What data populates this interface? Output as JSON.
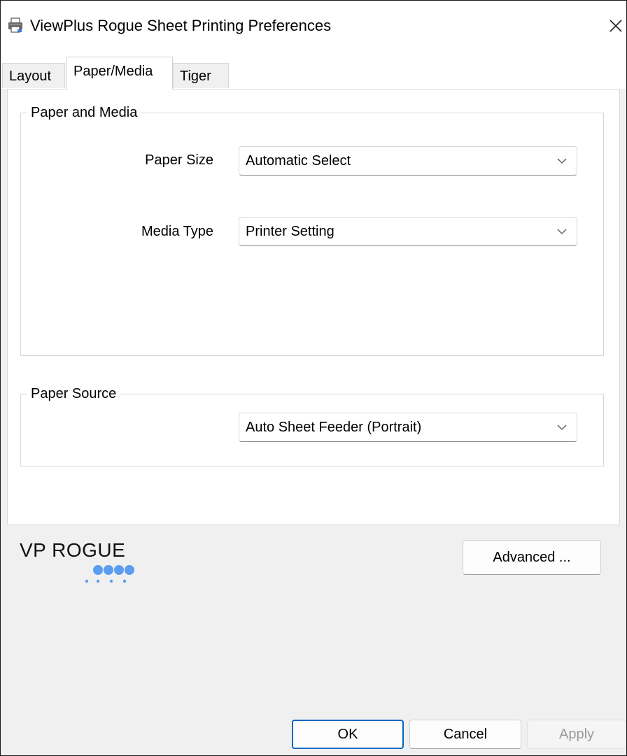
{
  "window": {
    "title": "ViewPlus Rogue Sheet Printing Preferences",
    "icon": "printer-icon",
    "close_icon": "close-icon"
  },
  "tabs": [
    {
      "label": "Layout",
      "active": false
    },
    {
      "label": "Paper/Media",
      "active": true
    },
    {
      "label": "Tiger",
      "active": false
    }
  ],
  "paper_and_media": {
    "group_label": "Paper and Media",
    "paper_size": {
      "label": "Paper Size",
      "value": "Automatic Select"
    },
    "media_type": {
      "label": "Media Type",
      "value": "Printer Setting"
    }
  },
  "paper_source": {
    "group_label": "Paper Source",
    "value": "Auto Sheet Feeder (Portrait)"
  },
  "logo": {
    "text": "VP ROGUE",
    "dot_color": "#5b9df0"
  },
  "advanced_button": {
    "label": "Advanced ..."
  },
  "footer": {
    "ok": "OK",
    "cancel": "Cancel",
    "apply": "Apply"
  },
  "colors": {
    "accent": "#0067c0",
    "disabled_text": "#9a9a9a"
  }
}
